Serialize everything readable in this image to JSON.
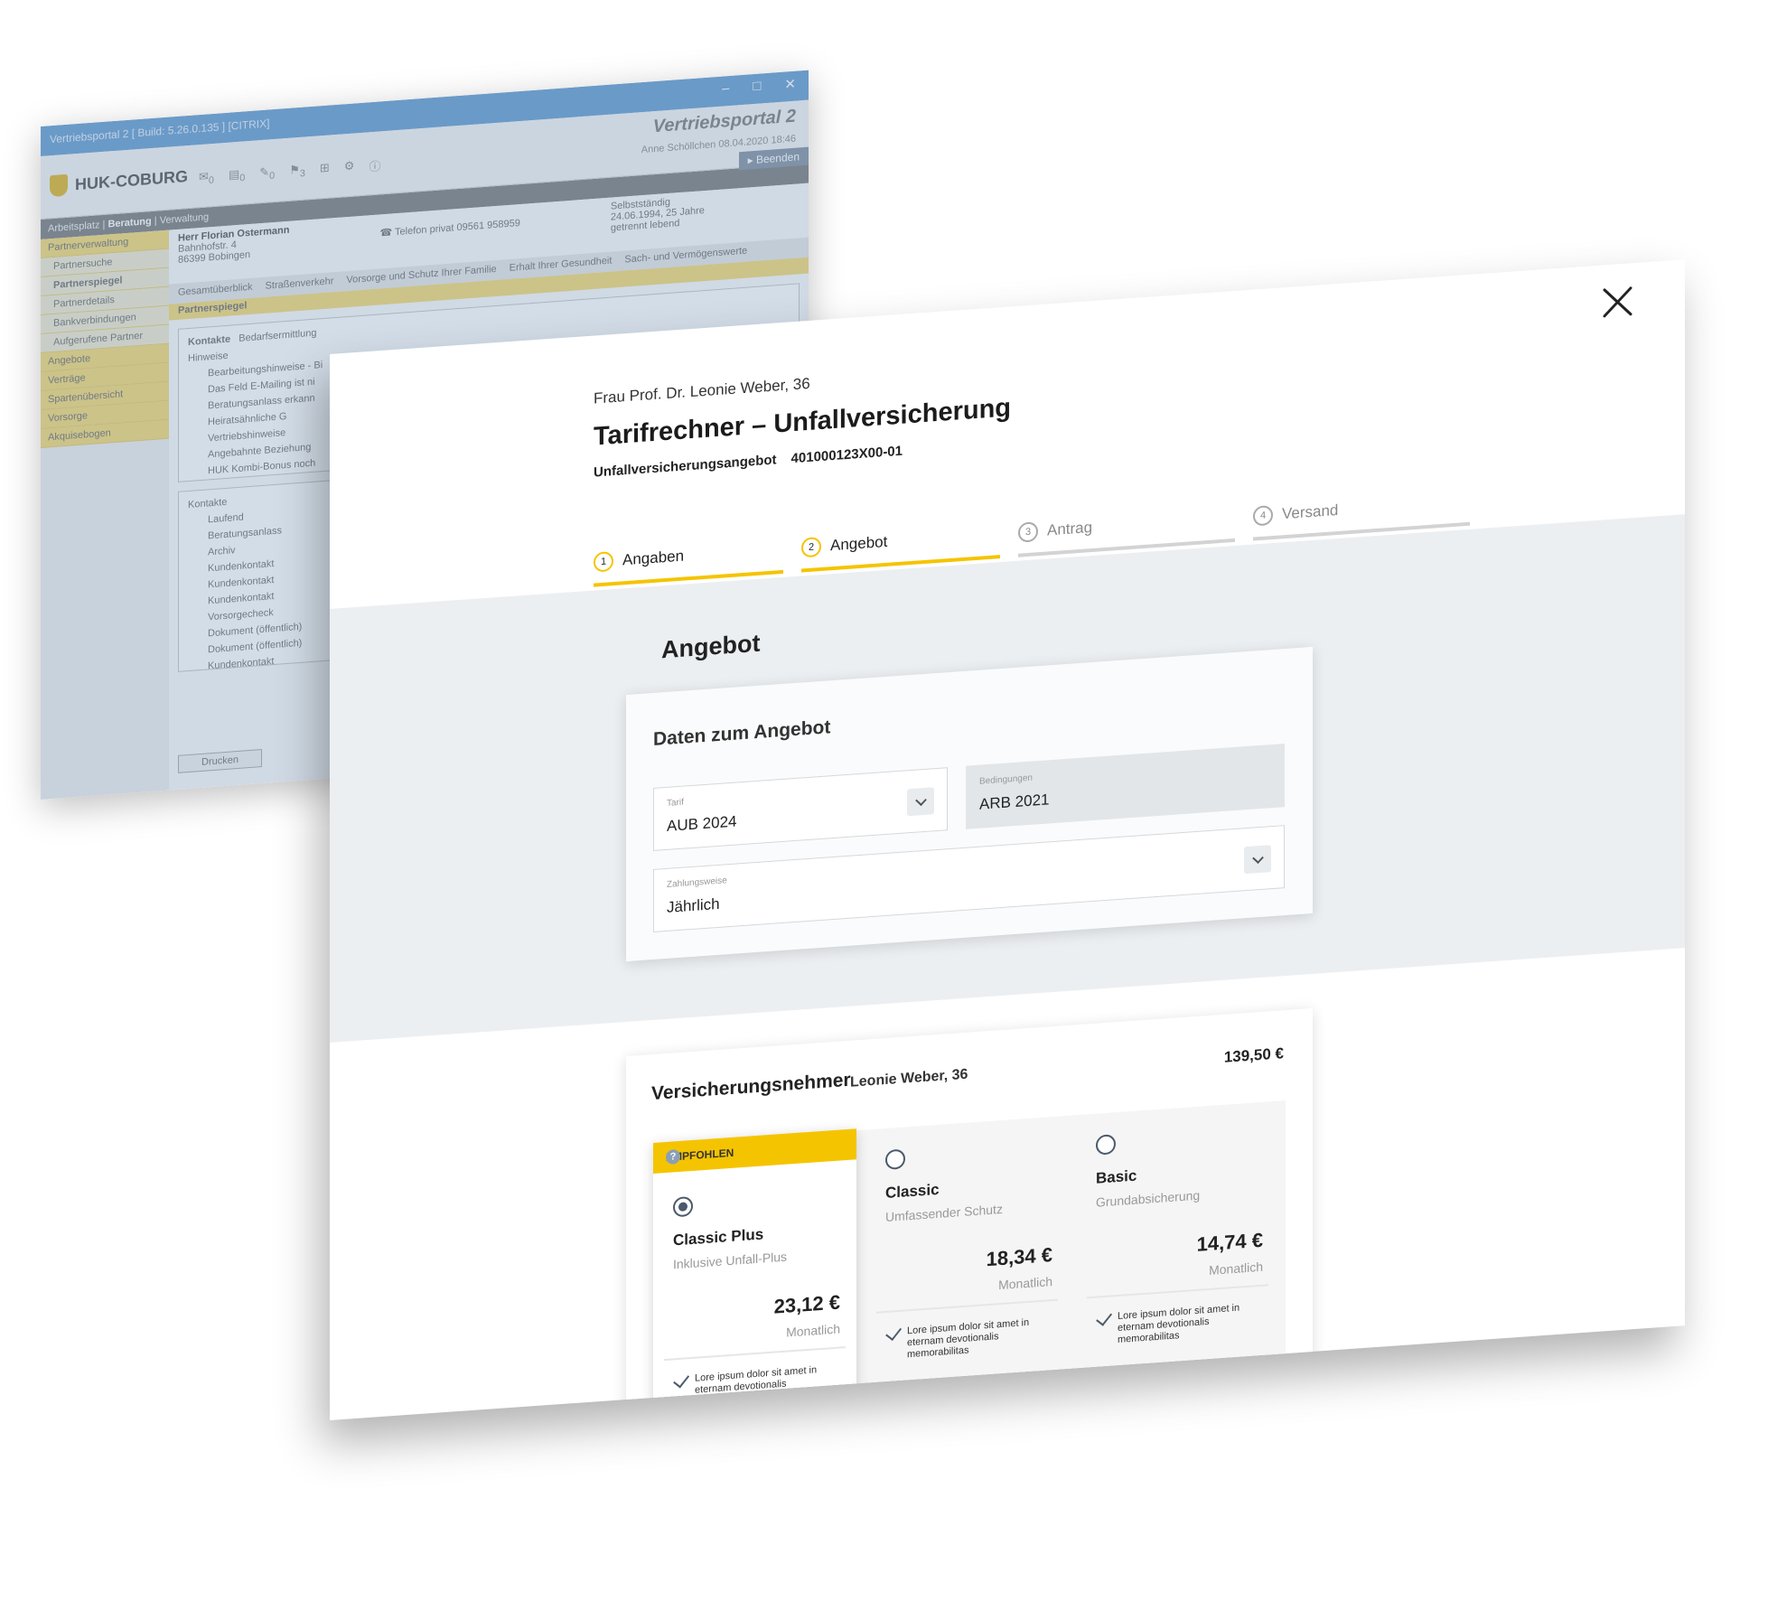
{
  "legacy": {
    "title": "Vertriebsportal 2   [ Build: 5.26.0.135 ] [CITRIX]",
    "brand": "Vertriebsportal 2",
    "company": "HUK-COBURG",
    "user": "Anne Schöllchen  08.04.2020 18:46",
    "logout": "Beenden",
    "toolbar": [
      "0",
      "0",
      "0",
      "3"
    ],
    "nav": {
      "a": "Arbeitsplatz",
      "b": "Beratung",
      "c": "Verwaltung"
    },
    "sidebar": [
      "Partnerverwaltung",
      "Partnersuche",
      "Partnerspiegel",
      "Partnerdetails",
      "Bankverbindungen",
      "Aufgerufene Partner",
      "Angebote",
      "Verträge",
      "Spartenübersicht",
      "Vorsorge",
      "Akquisebogen"
    ],
    "person": {
      "name": "Herr Florian Ostermann",
      "street": "Bahnhofstr. 4",
      "city": "86399 Bobingen",
      "phone": "Telefon privat 09561 958959",
      "job": "Selbstständig",
      "dob": "24.06.1994, 25 Jahre",
      "status": "getrennt lebend"
    },
    "tabs": [
      "Gesamtüberblick",
      "Straßenverkehr",
      "Vorsorge und Schutz Ihrer Familie",
      "Erhalt Ihrer Gesundheit",
      "Sach- und Vermögenswerte"
    ],
    "section": "Partnerspiegel",
    "subtabs": [
      "Kontakte",
      "Bedarfsermittlung"
    ],
    "hints": [
      "Hinweise",
      "Bearbeitungshinweise - Bi",
      "Das Feld E-Mailing ist ni",
      "Beratungsanlass erkann",
      "Heiratsähnliche G",
      "Vertriebshinweise",
      "Angebahnte Beziehung",
      "HUK Kombi-Bonus noch"
    ],
    "contacts": [
      "Kontakte",
      "Laufend",
      "Beratungsanlass",
      "Archiv",
      "Kundenkontakt",
      "Kundenkontakt",
      "Kundenkontakt",
      "Vorsorgecheck",
      "Dokument (öffentlich)",
      "Dokument (öffentlich)",
      "Kundenkontakt"
    ],
    "print": "Drucken"
  },
  "modal": {
    "customer": "Frau Prof. Dr. Leonie Weber, 36",
    "title": "Tarifrechner – Unfallversicherung",
    "offer_label": "Unfallversicherungsangebot",
    "offer_number": "401000123X00-01",
    "steps": [
      {
        "num": "1",
        "label": "Angaben"
      },
      {
        "num": "2",
        "label": "Angebot"
      },
      {
        "num": "3",
        "label": "Antrag"
      },
      {
        "num": "4",
        "label": "Versand"
      }
    ],
    "section_title": "Angebot",
    "data_card": {
      "title": "Daten zum Angebot",
      "tarif": {
        "label": "Tarif",
        "value": "AUB 2024"
      },
      "bedingungen": {
        "label": "Bedingungen",
        "value": "ARB 2021"
      },
      "zahlungsweise": {
        "label": "Zahlungsweise",
        "value": "Jährlich"
      }
    },
    "vn": {
      "title": "Versicherungsnehmer",
      "name": "Leonie Weber, 36",
      "total": "139,50 €",
      "badge": "EMPFOHLEN",
      "badge_help": "?",
      "plans": [
        {
          "name": "Classic Plus",
          "sub": "Inklusive Unfall-Plus",
          "price": "23,12 €",
          "freq": "Monatlich",
          "feature": "Lore ipsum dolor sit amet in eternam devotionalis memorabilitas"
        },
        {
          "name": "Classic",
          "sub": "Umfassender Schutz",
          "price": "18,34 €",
          "freq": "Monatlich",
          "feature": "Lore ipsum dolor sit amet in eternam devotionalis memorabilitas"
        },
        {
          "name": "Basic",
          "sub": "Grundabsicherung",
          "price": "14,74 €",
          "freq": "Monatlich",
          "feature": "Lore ipsum dolor sit amet in eternam devotionalis memorabilitas"
        }
      ]
    }
  }
}
